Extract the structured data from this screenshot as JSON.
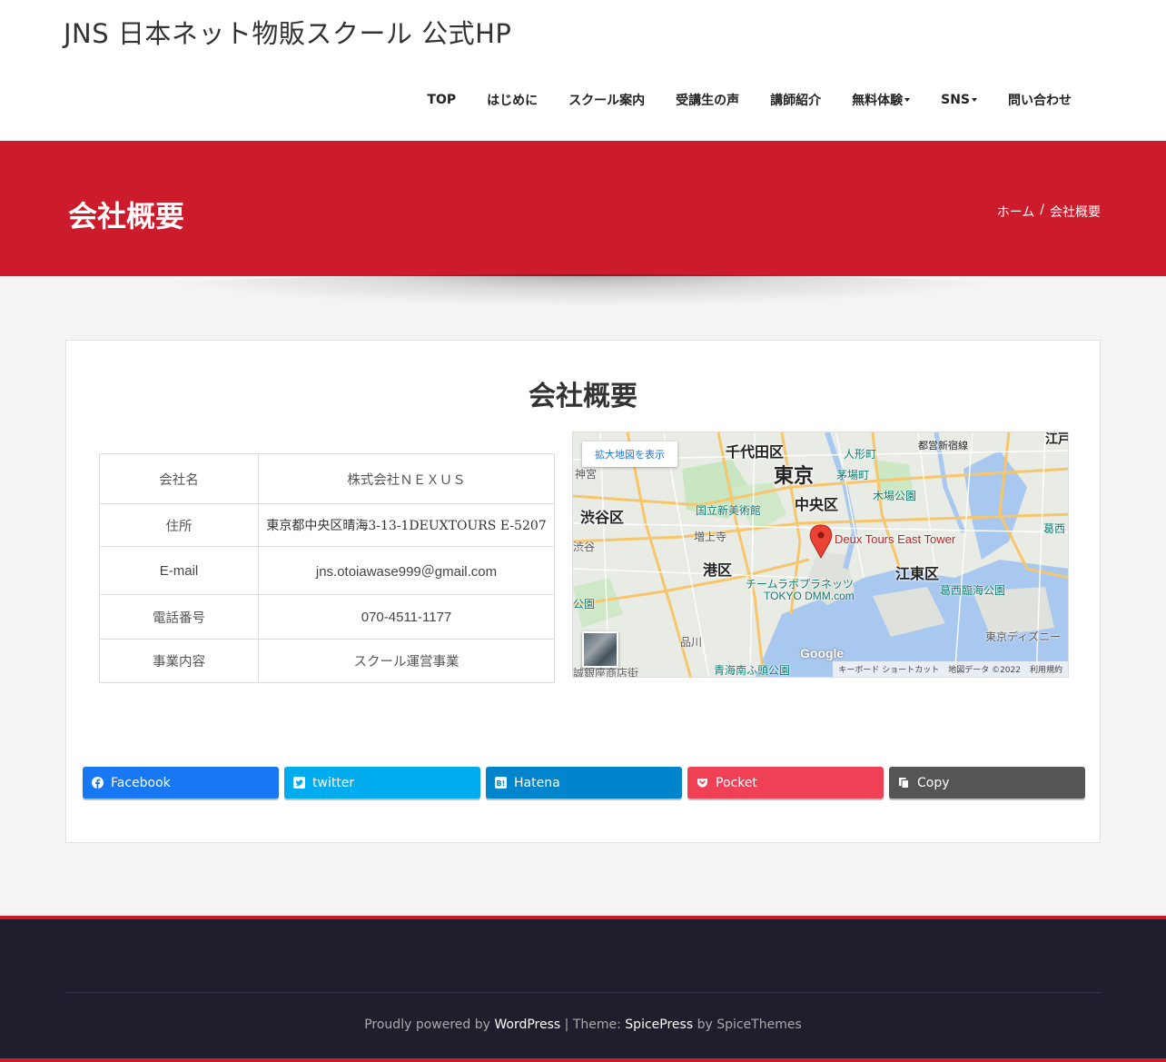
{
  "header": {
    "site_title": "JNS 日本ネット物販スクール 公式HP",
    "nav": [
      {
        "label": "TOP",
        "dropdown": false
      },
      {
        "label": "はじめに",
        "dropdown": false
      },
      {
        "label": "スクール案内",
        "dropdown": false
      },
      {
        "label": "受講生の声",
        "dropdown": false
      },
      {
        "label": "講師紹介",
        "dropdown": false
      },
      {
        "label": "無料体験",
        "dropdown": true
      },
      {
        "label": "SNS",
        "dropdown": true
      },
      {
        "label": "問い合わせ",
        "dropdown": false
      }
    ]
  },
  "banner": {
    "title": "会社概要",
    "breadcrumb_home": "ホーム",
    "breadcrumb_sep": "/",
    "breadcrumb_current": "会社概要",
    "color": "#cc1b2a"
  },
  "main": {
    "title": "会社概要",
    "table": [
      {
        "label": "会社名",
        "value": "株式会社ＮＥＸＵＳ"
      },
      {
        "label": "住所",
        "value": "東京都中央区晴海3-13-1DEUXTOURS E-5207"
      },
      {
        "label": "E-mail",
        "value": "jns.otoiawase999＠gmail.com"
      },
      {
        "label": "電話番号",
        "value": "070-4511-1177"
      },
      {
        "label": "事業内容",
        "value": "スクール運営事業"
      }
    ],
    "map": {
      "view_larger": "拡大地図を表示",
      "pin_label": "Deux Tours East Tower",
      "labels": {
        "chiyoda": "千代田区",
        "tokyo": "東京",
        "chuo": "中央区",
        "shibuya": "渋谷区",
        "minato": "港区",
        "koto": "江東区",
        "toshin": "都営新宿線",
        "ningyocho": "人形町",
        "kayabacho": "茅場町",
        "kibapark": "木場公園",
        "nact": "国立新美術館",
        "zojoji": "増上寺",
        "teamlab": "チームラボプラネッツ",
        "dmm": "TOKYO DMM.com",
        "kasai": "葛西臨海公園",
        "disney": "東京ディズニー",
        "shinagawa": "品川",
        "aomi": "青海南ふ頭公園",
        "ginza": "誠銀座商店街",
        "harajuku": "神宮",
        "shibuya_st": "渋谷",
        "park": "公園",
        "edo": "江戸",
        "kasai2": "葛西"
      },
      "google": "Google",
      "keyboard": "キーボード ショートカット",
      "mapdata": "地図データ ©2022",
      "terms": "利用規約"
    },
    "share": [
      {
        "label": "Facebook",
        "icon": "facebook-icon",
        "color": "#1877f2"
      },
      {
        "label": "twitter",
        "icon": "twitter-icon",
        "color": "#00acee"
      },
      {
        "label": "Hatena",
        "icon": "hatena-icon",
        "color": "#0084cc"
      },
      {
        "label": "Pocket",
        "icon": "pocket-icon",
        "color": "#ef4056"
      },
      {
        "label": "Copy",
        "icon": "copy-icon",
        "color": "#555555"
      }
    ]
  },
  "footer": {
    "powered": "Proudly powered by",
    "wordpress": "WordPress",
    "sep": "|",
    "theme": "Theme:",
    "spicepress": "SpicePress",
    "by": "by SpiceThemes"
  }
}
